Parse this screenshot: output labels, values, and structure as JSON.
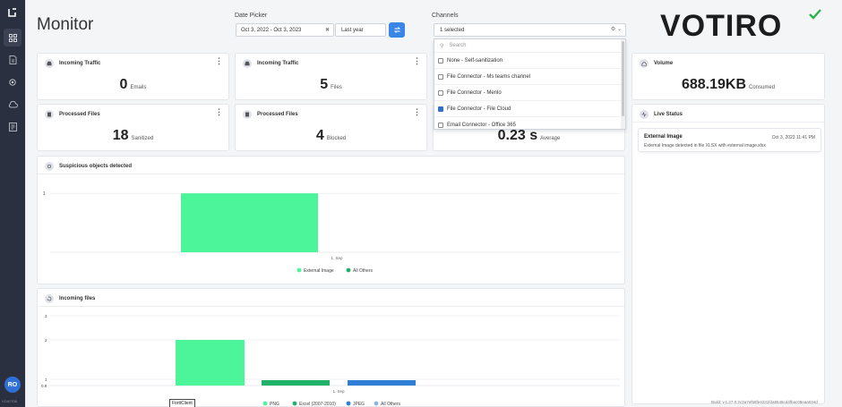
{
  "sidebar": {
    "items": [
      "dashboard-icon",
      "reports-icon",
      "settings-icon",
      "cloud-icon",
      "logs-icon"
    ],
    "avatar": "RO",
    "version": "VOIGT08"
  },
  "header": {
    "title": "Monitor",
    "date_picker": {
      "label": "Date Picker",
      "range": "Oct 3, 2022 - Oct 3, 2023",
      "quick": "Last year"
    },
    "channels": {
      "label": "Channels",
      "selected": "1 selected",
      "search_placeholder": "Search",
      "options": [
        {
          "label": "None - Self-sanitization",
          "checked": false
        },
        {
          "label": "File Connector - Ms teams channel",
          "checked": false
        },
        {
          "label": "File Connector - Menlo",
          "checked": false
        },
        {
          "label": "File Connector - File Cloud",
          "checked": true
        },
        {
          "label": "Email Connector - Office 365",
          "checked": false
        }
      ]
    },
    "brand": "VOTIRO",
    "brand_color": "#2bb34a"
  },
  "cards": {
    "incoming_emails": {
      "title": "Incoming Traffic",
      "value": "0",
      "unit": "Emails"
    },
    "incoming_files": {
      "title": "Incoming Traffic",
      "value": "5",
      "unit": "Files"
    },
    "processed_sanitized": {
      "title": "Processed Files",
      "value": "18",
      "unit": "Sanitized"
    },
    "processed_blocked": {
      "title": "Processed Files",
      "value": "4",
      "unit": "Blocked"
    },
    "avg_time": {
      "value": "0.23 s",
      "unit": "Average"
    },
    "volume": {
      "title": "Volume",
      "value": "688.19KB",
      "unit": "Consumed"
    }
  },
  "live_status": {
    "title": "Live Status",
    "items": [
      {
        "title": "External Image",
        "date": "Oct 3, 2023 11:41 PM",
        "message": "External Image detected in file XLSX with external image.xlsx"
      }
    ]
  },
  "suspicious": {
    "title": "Suspicious objects detected"
  },
  "incoming_chart": {
    "title": "Incoming files"
  },
  "tooltip": "FortiClient",
  "footer_version": "Build: v.1.27.0.2c3a7ef58fe4231fda8548cd4fbac08eaa034d",
  "chart_data": [
    {
      "type": "bar",
      "title": "Suspicious objects detected",
      "categories": [
        "1. Sep"
      ],
      "ytick_labels": [
        "1"
      ],
      "series": [
        {
          "name": "External Image",
          "values": [
            1
          ],
          "color": "#4cf59a"
        },
        {
          "name": "All Others",
          "values": [
            0
          ],
          "color": "#1fb36a"
        }
      ],
      "ylim": [
        0,
        1.2
      ]
    },
    {
      "type": "bar",
      "title": "Incoming files",
      "categories": [
        "1. Sep"
      ],
      "ytick_labels": [
        "0.9",
        "1",
        "2",
        "3"
      ],
      "series": [
        {
          "name": "PNG",
          "values": [
            2
          ],
          "color": "#4cf59a"
        },
        {
          "name": "Excel (2007-2010)",
          "values": [
            1
          ],
          "color": "#1fb36a"
        },
        {
          "name": "JPEG",
          "values": [
            1
          ],
          "color": "#2f7fd6"
        },
        {
          "name": "All Others",
          "values": [
            0
          ],
          "color": "#88b4e6"
        }
      ],
      "ylim": [
        0.9,
        3
      ]
    }
  ]
}
